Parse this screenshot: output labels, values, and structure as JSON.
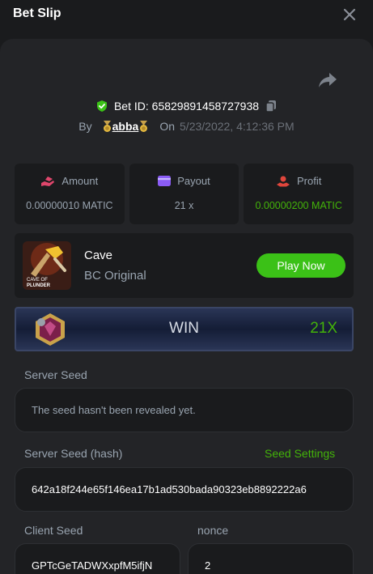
{
  "header": {
    "title": "Bet Slip"
  },
  "bet": {
    "id_label": "Bet ID:",
    "id": "65829891458727938",
    "by_label": "By",
    "username": "abba",
    "on_label": "On",
    "datetime": "5/23/2022, 4:12:36 PM"
  },
  "stats": {
    "amount": {
      "label": "Amount",
      "value": "0.00000010 MATIC"
    },
    "payout": {
      "label": "Payout",
      "value": "21 x"
    },
    "profit": {
      "label": "Profit",
      "value": "0.00000200 MATIC"
    }
  },
  "game": {
    "name": "Cave",
    "subtitle": "BC Original",
    "thumb_text_top": "CAVE OF",
    "thumb_text_bottom": "PLUNDER",
    "play_label": "Play Now"
  },
  "result": {
    "status": "WIN",
    "multiplier": "21X"
  },
  "server_seed": {
    "label": "Server Seed",
    "value": "The seed hasn't been revealed yet."
  },
  "server_seed_hash": {
    "label": "Server Seed (hash)",
    "value": "642a18f244e65f146ea17b1ad530bada90323eb8892222a6",
    "settings_label": "Seed Settings"
  },
  "client_seed": {
    "label": "Client Seed",
    "value": "GPTcGeTADWXxpfM5ifjN"
  },
  "nonce": {
    "label": "nonce",
    "value": "2"
  },
  "colors": {
    "background": "#1a1b1d",
    "card": "#232427",
    "accent_green": "#3bc117",
    "profit_green": "#43b309",
    "muted_text": "#99a4b0"
  },
  "icons": {
    "close": "close-icon",
    "share": "share-arrow-icon",
    "verified": "shield-check-icon",
    "copy": "copy-icon",
    "medal": "medal-icon",
    "amount": "coins-hand-icon",
    "payout": "wallet-card-icon",
    "profit": "profit-hand-icon",
    "gem": "gem-icon"
  }
}
